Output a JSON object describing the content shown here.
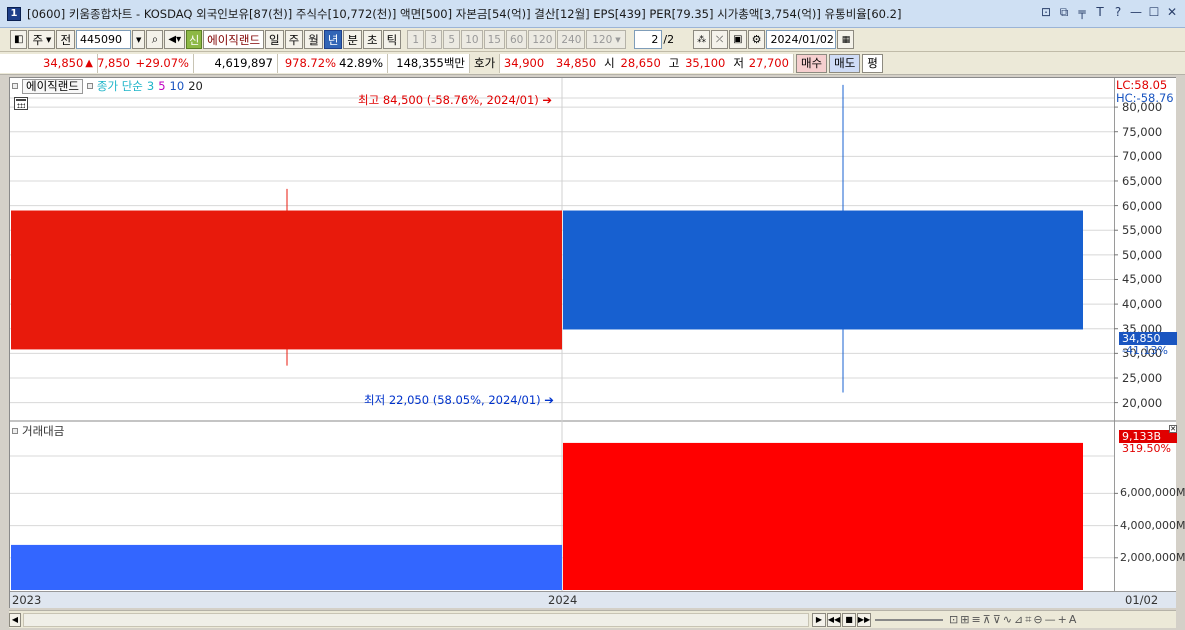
{
  "window": {
    "number": "1",
    "title": "[0600] 키움종합차트 - KOSDAQ 외국인보유[87(천)] 주식수[10,772(천)] 액면[500] 자본금[54(억)] 결산[12월] EPS[439] PER[79.35] 시가총액[3,754(억)] 유통비율[60.2]",
    "controls": [
      "⊡",
      "⧉",
      "╤",
      "T",
      "?",
      "—",
      "☐",
      "✕"
    ]
  },
  "toolbar": {
    "period_type": "주",
    "scope": "전",
    "code": "445090",
    "new_badge": "신",
    "stock_name": "에이직랜드",
    "periods": [
      "일",
      "주",
      "월",
      "년",
      "분",
      "초",
      "틱"
    ],
    "active_period": "년",
    "intervals": [
      "1",
      "3",
      "5",
      "10",
      "15",
      "60",
      "120",
      "240"
    ],
    "count": "120",
    "page": "2",
    "page_total": "/2",
    "date": "2024/01/02"
  },
  "quote": {
    "price": "34,850",
    "arrow": "▲",
    "change": "7,850",
    "change_pct": "+29.07%",
    "volume": "4,619,897",
    "volume_ratio": "978.72%",
    "turnover": "42.89%",
    "amount": "148,355백만",
    "ask_label": "호가",
    "ask1": "34,900",
    "ask2": "34,850",
    "open_label": "시",
    "open": "28,650",
    "high_label": "고",
    "high": "35,100",
    "low_label": "저",
    "low": "27,700",
    "buy": "매수",
    "sell": "매도",
    "avg": "평"
  },
  "legend": {
    "name": "에이직랜드",
    "ma_label": "종가 단순",
    "ma": [
      "3",
      "5",
      "10",
      "20"
    ]
  },
  "annotations": {
    "high": "최고 84,500 (-58.76%, 2024/01)",
    "low": "최저 22,050 (58.05%, 2024/01)",
    "lc": "LC:58.05",
    "hc": "HC:-58.76",
    "current_price": "34,850",
    "current_pct": "-41.13%",
    "volume_title": "거래대금",
    "volume_current": "9,133B",
    "volume_pct": "319.50%"
  },
  "colors": {
    "up": "#e81a0c",
    "down": "#1760d0",
    "volume_up": "#ff0000",
    "volume_down": "#3366ff"
  },
  "chart_data": {
    "type": "candlestick",
    "price_axis": {
      "ticks": [
        20000,
        25000,
        30000,
        35000,
        40000,
        45000,
        50000,
        55000,
        60000,
        65000,
        70000,
        75000,
        80000
      ],
      "tick_labels": [
        "20,000",
        "25,000",
        "30,000",
        "35,000",
        "40,000",
        "45,000",
        "50,000",
        "55,000",
        "60,000",
        "65,000",
        "70,000",
        "75,000",
        "80,000"
      ],
      "ylim": [
        18500,
        85500
      ]
    },
    "volume_axis": {
      "ticks": [
        2000000,
        4000000,
        6000000
      ],
      "tick_labels": [
        "2,000,000M",
        "4,000,000M",
        "6,000,000M"
      ],
      "ylim": [
        0,
        9500000
      ]
    },
    "categories": [
      "2023",
      "2024"
    ],
    "x_end_label": "01/02",
    "candles": [
      {
        "period": "2023",
        "open": 30800,
        "high": 63400,
        "low": 27500,
        "close": 59000
      },
      {
        "period": "2024",
        "open": 59000,
        "high": 84500,
        "low": 22050,
        "close": 34850
      }
    ],
    "volume": [
      2800000,
      9133000
    ]
  },
  "scroll": {
    "tools": [
      "⊡",
      "⊞",
      "≡",
      "⊼",
      "⊽",
      "∿",
      "⊿",
      "⌗",
      "⊖",
      "—",
      "+",
      "A"
    ]
  }
}
